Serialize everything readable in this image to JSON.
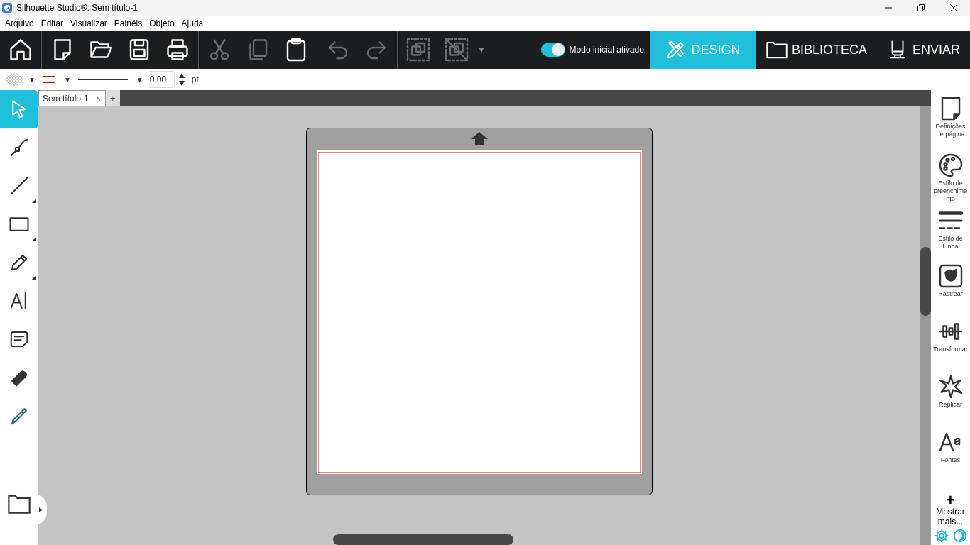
{
  "window": {
    "title": "Silhouette Studio®: Sem título-1"
  },
  "menu": [
    "Arquivo",
    "Editar",
    "Visualizar",
    "Painéis",
    "Objeto",
    "Ajuda"
  ],
  "toolbar": [
    {
      "kind": "home",
      "disabled": false
    },
    {
      "kind": "new",
      "disabled": false
    },
    {
      "kind": "open",
      "disabled": false
    },
    {
      "kind": "save",
      "disabled": false
    },
    {
      "kind": "print",
      "disabled": false
    },
    {
      "kind": "cut",
      "disabled": true
    },
    {
      "kind": "copy",
      "disabled": true
    },
    {
      "kind": "paste",
      "disabled": false
    },
    {
      "kind": "undo",
      "disabled": true
    },
    {
      "kind": "redo",
      "disabled": true
    },
    {
      "kind": "group",
      "disabled": true
    },
    {
      "kind": "ungroup",
      "disabled": true
    }
  ],
  "toolbar_dropdown": "▼",
  "mode_toggle": {
    "label": "Modo inicial ativado",
    "on": true
  },
  "nav_tabs": [
    {
      "kind": "design",
      "label": "DESIGN",
      "selected": true
    },
    {
      "kind": "library",
      "label": "BIBLIOTECA",
      "selected": false
    },
    {
      "kind": "send",
      "label": "ENVIAR",
      "selected": false
    }
  ],
  "properties": {
    "fill_caret": "▼",
    "stroke_caret": "▼",
    "line_caret": "▼",
    "width_value": "0,00",
    "unit": "pt"
  },
  "doc_tabs": [
    {
      "label": "Sem título-1",
      "close": "×",
      "selected": true
    }
  ],
  "new_tab": "+",
  "left_tools": [
    {
      "kind": "select",
      "selected": true,
      "submenu": false
    },
    {
      "kind": "node",
      "selected": false,
      "submenu": false
    },
    {
      "kind": "line",
      "selected": false,
      "submenu": true
    },
    {
      "kind": "rect",
      "selected": false,
      "submenu": true
    },
    {
      "kind": "pencil",
      "selected": false,
      "submenu": true
    },
    {
      "kind": "text",
      "selected": false,
      "submenu": false
    },
    {
      "kind": "note",
      "selected": false,
      "submenu": false
    },
    {
      "kind": "eraser",
      "selected": false,
      "submenu": false
    },
    {
      "kind": "knife",
      "selected": false,
      "submenu": false
    }
  ],
  "right_panels": [
    {
      "kind": "page",
      "label": "Definições de página"
    },
    {
      "kind": "palette",
      "label": "Estilo de preenchimento"
    },
    {
      "kind": "linestyle",
      "label": "Estilo de Linha"
    },
    {
      "kind": "trace",
      "label": "Rastrear"
    },
    {
      "kind": "transform",
      "label": "Transformar"
    },
    {
      "kind": "replicate",
      "label": "Replicar"
    },
    {
      "kind": "fonts",
      "label": "Fontes"
    }
  ],
  "show_more": {
    "icon": "+",
    "label": "Mostrar mais..."
  }
}
